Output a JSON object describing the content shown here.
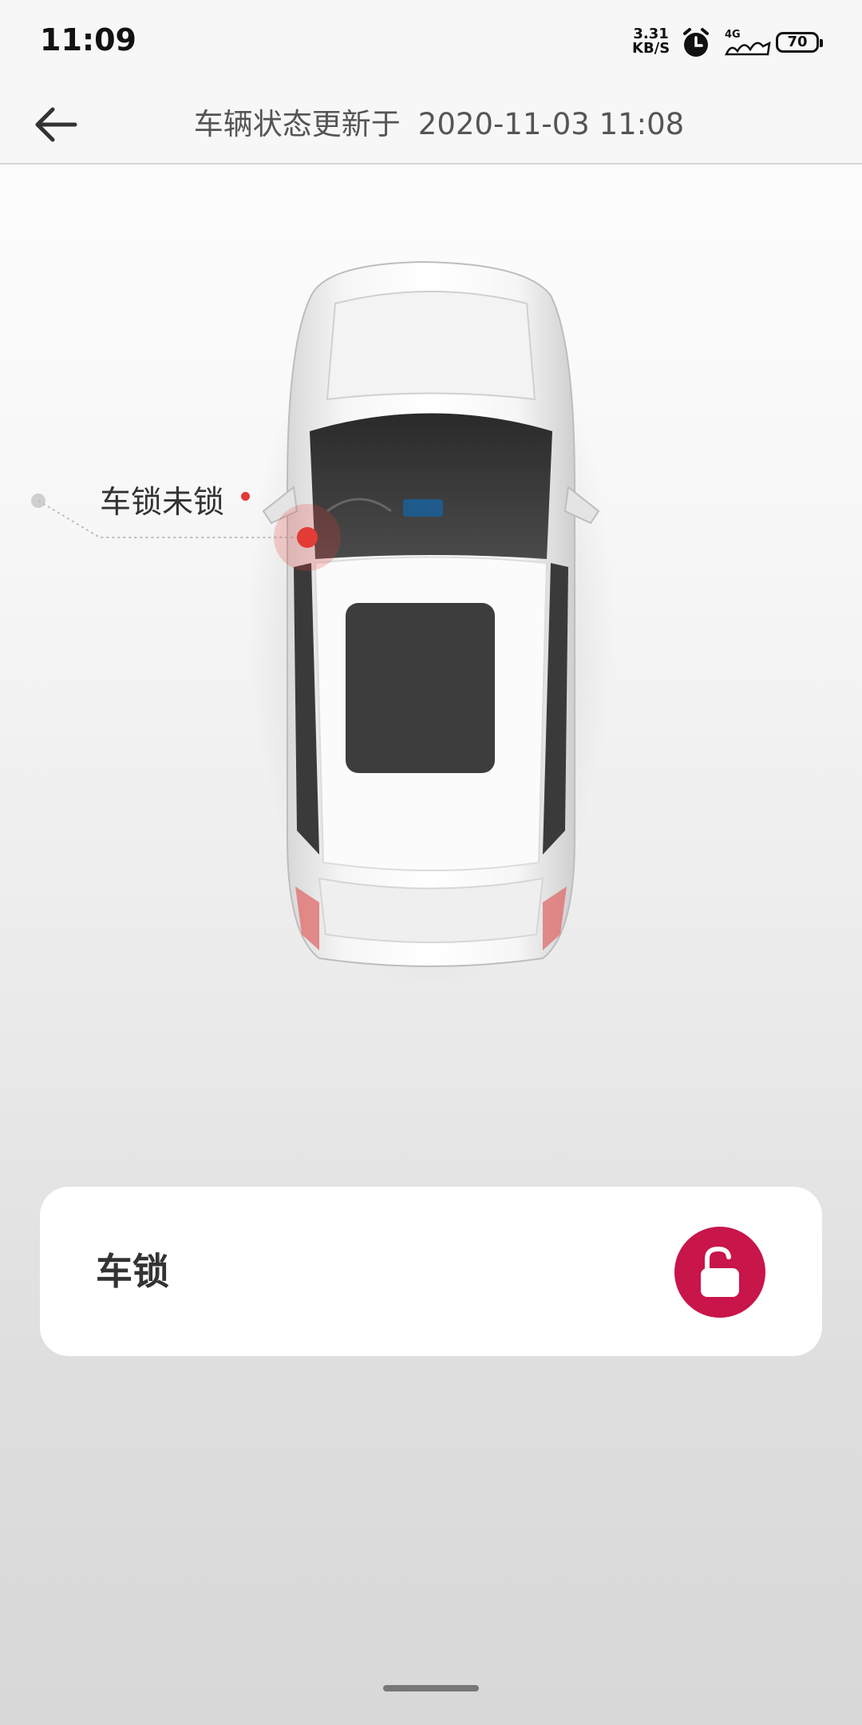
{
  "status_bar": {
    "time": "11:09",
    "net_speed_value": "3.31",
    "net_speed_unit": "KB/S",
    "network_type": "4G",
    "battery_level": "70"
  },
  "header": {
    "title_prefix": "车辆状态更新于",
    "updated_at": "2020-11-03 11:08"
  },
  "vehicle": {
    "lock_status_label": "车锁未锁",
    "alert_color": "#e33b36"
  },
  "lock_card": {
    "label": "车锁",
    "button_icon": "unlocked-padlock-icon",
    "button_color": "#c8154a"
  }
}
